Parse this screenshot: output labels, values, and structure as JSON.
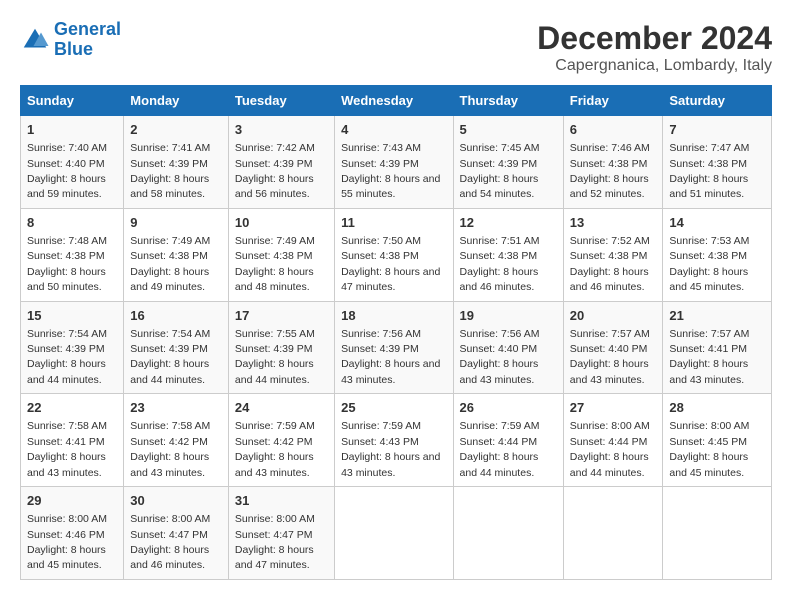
{
  "header": {
    "logo_line1": "General",
    "logo_line2": "Blue",
    "title": "December 2024",
    "subtitle": "Capergnanica, Lombardy, Italy"
  },
  "columns": [
    "Sunday",
    "Monday",
    "Tuesday",
    "Wednesday",
    "Thursday",
    "Friday",
    "Saturday"
  ],
  "weeks": [
    [
      {
        "day": "1",
        "sunrise": "7:40 AM",
        "sunset": "4:40 PM",
        "daylight": "8 hours and 59 minutes."
      },
      {
        "day": "2",
        "sunrise": "7:41 AM",
        "sunset": "4:39 PM",
        "daylight": "8 hours and 58 minutes."
      },
      {
        "day": "3",
        "sunrise": "7:42 AM",
        "sunset": "4:39 PM",
        "daylight": "8 hours and 56 minutes."
      },
      {
        "day": "4",
        "sunrise": "7:43 AM",
        "sunset": "4:39 PM",
        "daylight": "8 hours and 55 minutes."
      },
      {
        "day": "5",
        "sunrise": "7:45 AM",
        "sunset": "4:39 PM",
        "daylight": "8 hours and 54 minutes."
      },
      {
        "day": "6",
        "sunrise": "7:46 AM",
        "sunset": "4:38 PM",
        "daylight": "8 hours and 52 minutes."
      },
      {
        "day": "7",
        "sunrise": "7:47 AM",
        "sunset": "4:38 PM",
        "daylight": "8 hours and 51 minutes."
      }
    ],
    [
      {
        "day": "8",
        "sunrise": "7:48 AM",
        "sunset": "4:38 PM",
        "daylight": "8 hours and 50 minutes."
      },
      {
        "day": "9",
        "sunrise": "7:49 AM",
        "sunset": "4:38 PM",
        "daylight": "8 hours and 49 minutes."
      },
      {
        "day": "10",
        "sunrise": "7:49 AM",
        "sunset": "4:38 PM",
        "daylight": "8 hours and 48 minutes."
      },
      {
        "day": "11",
        "sunrise": "7:50 AM",
        "sunset": "4:38 PM",
        "daylight": "8 hours and 47 minutes."
      },
      {
        "day": "12",
        "sunrise": "7:51 AM",
        "sunset": "4:38 PM",
        "daylight": "8 hours and 46 minutes."
      },
      {
        "day": "13",
        "sunrise": "7:52 AM",
        "sunset": "4:38 PM",
        "daylight": "8 hours and 46 minutes."
      },
      {
        "day": "14",
        "sunrise": "7:53 AM",
        "sunset": "4:38 PM",
        "daylight": "8 hours and 45 minutes."
      }
    ],
    [
      {
        "day": "15",
        "sunrise": "7:54 AM",
        "sunset": "4:39 PM",
        "daylight": "8 hours and 44 minutes."
      },
      {
        "day": "16",
        "sunrise": "7:54 AM",
        "sunset": "4:39 PM",
        "daylight": "8 hours and 44 minutes."
      },
      {
        "day": "17",
        "sunrise": "7:55 AM",
        "sunset": "4:39 PM",
        "daylight": "8 hours and 44 minutes."
      },
      {
        "day": "18",
        "sunrise": "7:56 AM",
        "sunset": "4:39 PM",
        "daylight": "8 hours and 43 minutes."
      },
      {
        "day": "19",
        "sunrise": "7:56 AM",
        "sunset": "4:40 PM",
        "daylight": "8 hours and 43 minutes."
      },
      {
        "day": "20",
        "sunrise": "7:57 AM",
        "sunset": "4:40 PM",
        "daylight": "8 hours and 43 minutes."
      },
      {
        "day": "21",
        "sunrise": "7:57 AM",
        "sunset": "4:41 PM",
        "daylight": "8 hours and 43 minutes."
      }
    ],
    [
      {
        "day": "22",
        "sunrise": "7:58 AM",
        "sunset": "4:41 PM",
        "daylight": "8 hours and 43 minutes."
      },
      {
        "day": "23",
        "sunrise": "7:58 AM",
        "sunset": "4:42 PM",
        "daylight": "8 hours and 43 minutes."
      },
      {
        "day": "24",
        "sunrise": "7:59 AM",
        "sunset": "4:42 PM",
        "daylight": "8 hours and 43 minutes."
      },
      {
        "day": "25",
        "sunrise": "7:59 AM",
        "sunset": "4:43 PM",
        "daylight": "8 hours and 43 minutes."
      },
      {
        "day": "26",
        "sunrise": "7:59 AM",
        "sunset": "4:44 PM",
        "daylight": "8 hours and 44 minutes."
      },
      {
        "day": "27",
        "sunrise": "8:00 AM",
        "sunset": "4:44 PM",
        "daylight": "8 hours and 44 minutes."
      },
      {
        "day": "28",
        "sunrise": "8:00 AM",
        "sunset": "4:45 PM",
        "daylight": "8 hours and 45 minutes."
      }
    ],
    [
      {
        "day": "29",
        "sunrise": "8:00 AM",
        "sunset": "4:46 PM",
        "daylight": "8 hours and 45 minutes."
      },
      {
        "day": "30",
        "sunrise": "8:00 AM",
        "sunset": "4:47 PM",
        "daylight": "8 hours and 46 minutes."
      },
      {
        "day": "31",
        "sunrise": "8:00 AM",
        "sunset": "4:47 PM",
        "daylight": "8 hours and 47 minutes."
      },
      null,
      null,
      null,
      null
    ]
  ]
}
